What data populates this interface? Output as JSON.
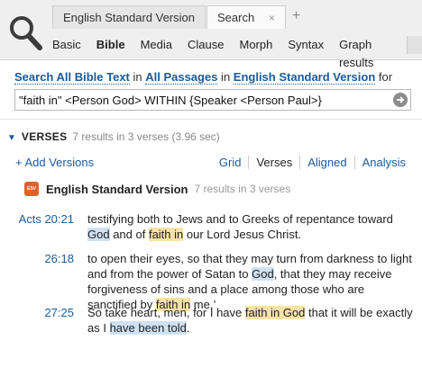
{
  "tabs": [
    {
      "label": "English Standard Version"
    },
    {
      "label": "Search"
    }
  ],
  "icons": {
    "search": "search-icon",
    "close": "close-icon",
    "add_tab": "plus-icon",
    "go": "arrow-right-circle-icon",
    "collapse": "triangle-down-icon",
    "version_logo": "esv-logo-icon"
  },
  "tab_close_glyph": "×",
  "tab_add_glyph": "+",
  "subnav": {
    "basic": "Basic",
    "bible": "Bible",
    "media": "Media",
    "clause": "Clause",
    "morph": "Morph",
    "syntax": "Syntax",
    "graph_results": "Graph results"
  },
  "query_line": {
    "part1": "Search All Bible Text",
    "part2": " in ",
    "part3": "All Passages",
    "part4": " in ",
    "part5": "English Standard Version",
    "part6": " for"
  },
  "query_value": "\"faith in\" <Person God> WITHIN {Speaker <Person Paul>}",
  "results_section": {
    "collapse_glyph": "▼",
    "title": "VERSES",
    "meta": "7 results in 3 verses (3.96 sec)"
  },
  "add_versions": {
    "plus": "+",
    "label": " Add Versions"
  },
  "view_tabs": {
    "grid": "Grid",
    "verses": "Verses",
    "aligned": "Aligned",
    "analysis": "Analysis"
  },
  "version": {
    "logo_text": "ESV",
    "name": "English Standard Version",
    "count": "7 results in 3 verses"
  },
  "verses": [
    {
      "ref": "Acts 20:21",
      "t1": "testifying both to Jews and to Greeks of repentance toward ",
      "h1": "God",
      "t2": " and of ",
      "h2": "faith in",
      "t3": " our Lord Jesus Christ."
    },
    {
      "ref": "26:18",
      "t1": "to open their eyes, so that they may turn from darkness to light and from the power of Satan to ",
      "h1": "God",
      "t2": ", that they may receive forgiveness of sins and a place among those who are sanctified by ",
      "h2": "faith in",
      "t3": " me.’"
    },
    {
      "ref": "27:25",
      "t1": "So take heart, men, for I have ",
      "h1": "faith in God",
      "t2": " that it will be exactly as I ",
      "h2": "have been told",
      "t3": "."
    }
  ],
  "colors": {
    "link": "#1b5a9b",
    "highlight_blue": "#cfe1f3",
    "highlight_yellow": "#f7e3a6",
    "esv_logo": "#e0612a"
  }
}
